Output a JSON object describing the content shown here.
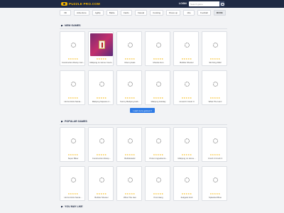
{
  "header": {
    "logo_text": "PUZZLE PRO.COM",
    "login_label": "LOGIN",
    "search_placeholder": "Search game"
  },
  "categories": [
    "3D",
    "Adventure",
    "Agility",
    "Battle",
    "Cards",
    "Casual",
    "Cooking",
    "Dress up",
    "Idle",
    "Football"
  ],
  "more_label": "MORE",
  "sections": {
    "new_games_title": "NEW GAMES",
    "popular_games_title": "POPULAR GAMES",
    "you_may_like_title": "YOU MAY LIKE"
  },
  "stars_glyph": "★★★★★",
  "new_games": [
    {
      "name": "Construction Ramp Jum...",
      "thumb": "loading"
    },
    {
      "name": "Mahjong Jo Home Cours...",
      "thumb": "mahjong"
    },
    {
      "name": "Moon pixels",
      "thumb": "loading"
    },
    {
      "name": "Muscle Gun",
      "thumb": "loading"
    },
    {
      "name": "Bubble Shooter",
      "thumb": "loading"
    },
    {
      "name": "Ski King 2022",
      "thumb": "loading"
    },
    {
      "name": "Hit And Hits Santa...",
      "thumb": "loading"
    },
    {
      "name": "Mahjong Squares 2...",
      "thumb": "loading"
    },
    {
      "name": "Sunny Mahjong Hab...",
      "thumb": "loading"
    },
    {
      "name": "Mahjong Holiday",
      "thumb": "loading"
    },
    {
      "name": "Crowd It Crush It",
      "thumb": "loading"
    },
    {
      "name": "What The Hen!",
      "thumb": "loading"
    }
  ],
  "load_more_label": "Load more games ▾",
  "popular_games": [
    {
      "name": "Super Biker",
      "thumb": "loading"
    },
    {
      "name": "Construction Ramp...",
      "thumb": "loading"
    },
    {
      "name": "Bubbletastic",
      "thumb": "loading"
    },
    {
      "name": "Potion Ingredients...",
      "thumb": "loading"
    },
    {
      "name": "Mahjong Jo Home...",
      "thumb": "loading"
    },
    {
      "name": "Crush It Crush It",
      "thumb": "loading"
    },
    {
      "name": "Hit And Hits Santa...",
      "thumb": "loading"
    },
    {
      "name": "Bubble Shooter",
      "thumb": "loading"
    },
    {
      "name": "What The Hen",
      "thumb": "loading"
    },
    {
      "name": "Pool Hang",
      "thumb": "loading"
    },
    {
      "name": "Zeitgeist Grid",
      "thumb": "loading"
    },
    {
      "name": "Splashed Blue",
      "thumb": "loading"
    }
  ]
}
